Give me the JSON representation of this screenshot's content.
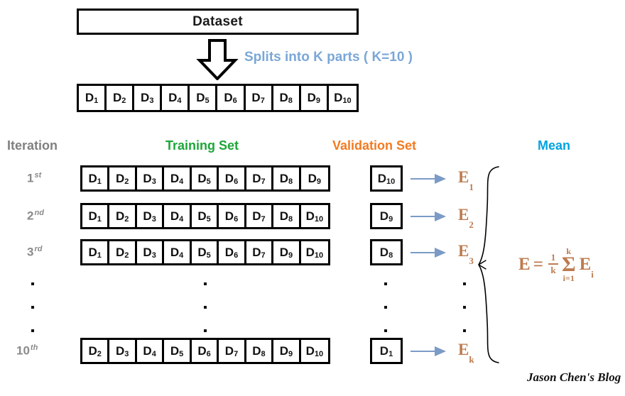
{
  "title": "K-Fold Cross Validation Diagram",
  "dataset": {
    "label": "Dataset"
  },
  "split_note": {
    "text": "Splits into K parts ( K=10 )",
    "color": "#7BA7D7"
  },
  "split_strip": {
    "cells": [
      "D1",
      "D2",
      "D3",
      "D4",
      "D5",
      "D6",
      "D7",
      "D8",
      "D9",
      "D10"
    ]
  },
  "headers": {
    "iteration": {
      "label": "Iteration",
      "color": "#808080"
    },
    "training": {
      "label": "Training Set",
      "color": "#1DA639"
    },
    "validation": {
      "label": "Validation Set",
      "color": "#F47A20"
    },
    "mean": {
      "label": "Mean",
      "color": "#00A3E0"
    }
  },
  "rows": [
    {
      "iteration_number": "1",
      "iteration_suffix": "st",
      "training": [
        "D1",
        "D2",
        "D3",
        "D4",
        "D5",
        "D6",
        "D7",
        "D8",
        "D9"
      ],
      "validation": "D10",
      "error": "E",
      "error_sub": "1"
    },
    {
      "iteration_number": "2",
      "iteration_suffix": "nd",
      "training": [
        "D1",
        "D2",
        "D3",
        "D4",
        "D5",
        "D6",
        "D7",
        "D8",
        "D10"
      ],
      "validation": "D9",
      "error": "E",
      "error_sub": "2"
    },
    {
      "iteration_number": "3",
      "iteration_suffix": "rd",
      "training": [
        "D1",
        "D2",
        "D3",
        "D4",
        "D5",
        "D6",
        "D7",
        "D9",
        "D10"
      ],
      "validation": "D8",
      "error": "E",
      "error_sub": "3"
    },
    {
      "iteration_number": "10",
      "iteration_suffix": "th",
      "training": [
        "D2",
        "D3",
        "D4",
        "D5",
        "D6",
        "D7",
        "D8",
        "D9",
        "D10"
      ],
      "validation": "D1",
      "error": "E",
      "error_sub": "k"
    }
  ],
  "ellipsis": {
    "dot_count": 3,
    "columns": [
      "iteration",
      "training",
      "validation",
      "error"
    ]
  },
  "mean_formula": {
    "lhs": "E",
    "equals": "=",
    "fraction_numerator": "1",
    "fraction_denominator": "k",
    "sum_upper": "k",
    "sum_symbol": "Σ",
    "sum_lower": "i=1",
    "term": "E",
    "term_sub": "i",
    "color": "#BD7B4F"
  },
  "signature": {
    "text": "Jason Chen's Blog"
  },
  "colors": {
    "box_border": "#000000",
    "error_brown": "#BD7B4F",
    "arrow_blue": "#7B9BC6",
    "iteration_gray": "#8a8a8a"
  }
}
